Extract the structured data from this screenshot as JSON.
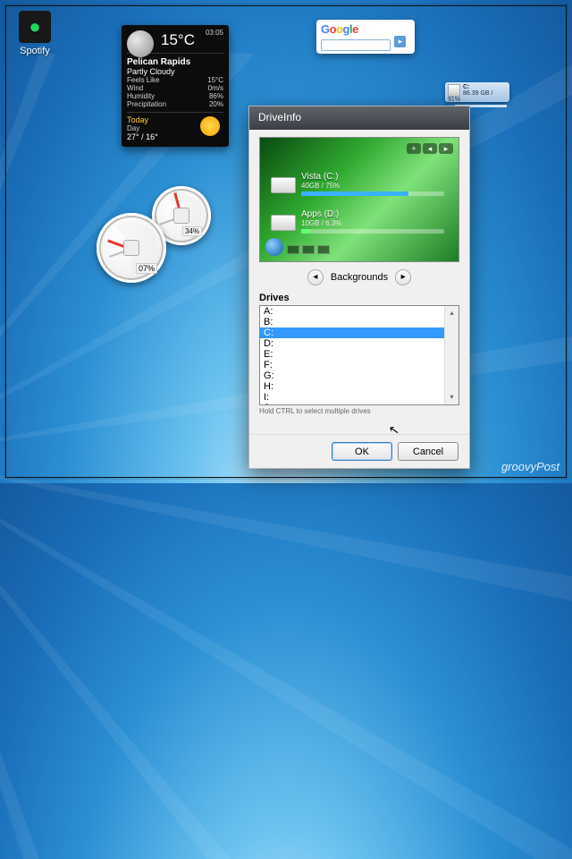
{
  "desktop": {
    "icon_label": "Spotify"
  },
  "weather": {
    "clock": "03:05",
    "temp": "15°C",
    "location": "Pelican Rapids",
    "condition": "Partly Cloudy",
    "rows": {
      "feels_label": "Feels Like",
      "feels_val": "15°C",
      "wind_label": "Wind",
      "wind_val": "0m/s",
      "hum_label": "Humidity",
      "hum_val": "86%",
      "prec_label": "Precipitation",
      "prec_val": "20%"
    },
    "today_label": "Today",
    "today_sub": "Day",
    "today_hilo": "27° / 16°"
  },
  "google": {
    "letters": [
      "G",
      "o",
      "o",
      "g",
      "l",
      "e"
    ],
    "go": "▸"
  },
  "mini_drive": {
    "label": "C:",
    "stats": "86.39 GB / 91%"
  },
  "gauges": {
    "g1": "07%",
    "g2": "34%"
  },
  "dialog": {
    "title": "DriveInfo",
    "preview": {
      "drive1_name": "Vista (C:)",
      "drive1_stats": "40GB / 75%",
      "drive2_name": "Apps (D:)",
      "drive2_stats": "10GB / 6.3%",
      "plus": "+",
      "prev": "◂",
      "next": "▸"
    },
    "bg_label": "Backgrounds",
    "bg_prev": "◂",
    "bg_next": "▸",
    "drives_label": "Drives",
    "drives": [
      "A:",
      "B:",
      "C:",
      "D:",
      "E:",
      "F:",
      "G:",
      "H:",
      "I:",
      "J:"
    ],
    "selected_index": 2,
    "hint": "Hold CTRL to select multiple drives",
    "ok": "OK",
    "cancel": "Cancel"
  },
  "watermark": "groovyPost"
}
